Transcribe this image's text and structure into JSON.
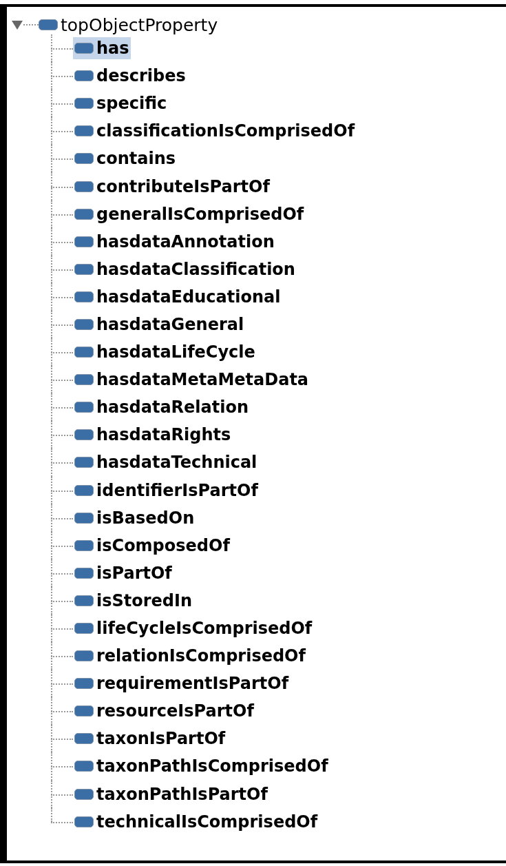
{
  "tree": {
    "label": "topObjectProperty",
    "expanded": true,
    "children": [
      {
        "label": "has",
        "selected": true
      },
      {
        "label": "describes",
        "selected": false
      },
      {
        "label": "specific",
        "selected": false
      },
      {
        "label": "classificationIsComprisedOf",
        "selected": false
      },
      {
        "label": "contains",
        "selected": false
      },
      {
        "label": "contributeIsPartOf",
        "selected": false
      },
      {
        "label": "generalIsComprisedOf",
        "selected": false
      },
      {
        "label": "hasdataAnnotation",
        "selected": false
      },
      {
        "label": "hasdataClassification",
        "selected": false
      },
      {
        "label": "hasdataEducational",
        "selected": false
      },
      {
        "label": "hasdataGeneral",
        "selected": false
      },
      {
        "label": "hasdataLifeCycle",
        "selected": false
      },
      {
        "label": "hasdataMetaMetaData",
        "selected": false
      },
      {
        "label": "hasdataRelation",
        "selected": false
      },
      {
        "label": "hasdataRights",
        "selected": false
      },
      {
        "label": "hasdataTechnical",
        "selected": false
      },
      {
        "label": "identifierIsPartOf",
        "selected": false
      },
      {
        "label": "isBasedOn",
        "selected": false
      },
      {
        "label": "isComposedOf",
        "selected": false
      },
      {
        "label": "isPartOf",
        "selected": false
      },
      {
        "label": "isStoredIn",
        "selected": false
      },
      {
        "label": "lifeCycleIsComprisedOf",
        "selected": false
      },
      {
        "label": "relationIsComprisedOf",
        "selected": false
      },
      {
        "label": "requirementIsPartOf",
        "selected": false
      },
      {
        "label": "resourceIsPartOf",
        "selected": false
      },
      {
        "label": "taxonIsPartOf",
        "selected": false
      },
      {
        "label": "taxonPathIsComprisedOf",
        "selected": false
      },
      {
        "label": "taxonPathIsPartOf",
        "selected": false
      },
      {
        "label": "technicalIsComprisedOf",
        "selected": false
      }
    ]
  }
}
